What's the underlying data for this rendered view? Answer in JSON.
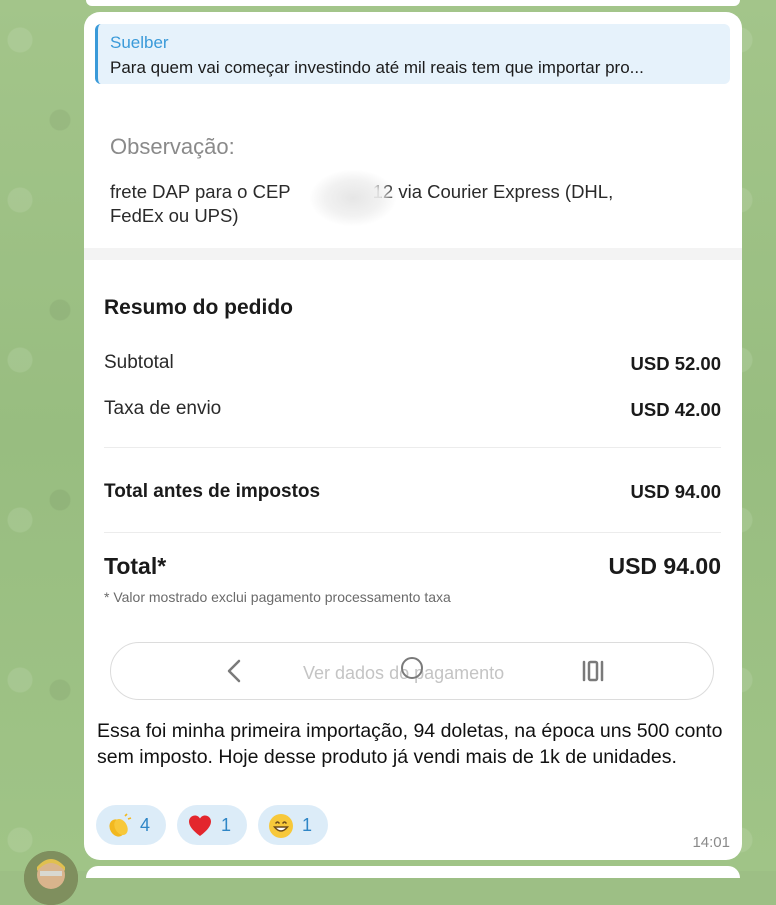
{
  "reply": {
    "author": "Suelber",
    "text": "Para quem vai começar investindo até mil reais tem que importar pro..."
  },
  "observation": {
    "label": "Observação:",
    "text_before": "frete DAP para o CEP",
    "text_after": "12 via Courier Express (DHL, FedEx ou UPS)"
  },
  "summary": {
    "title": "Resumo do pedido",
    "rows": [
      {
        "label": "Subtotal",
        "value": "USD 52.00"
      },
      {
        "label": "Taxa de envio",
        "value": "USD 42.00"
      },
      {
        "label": "Total antes de impostos",
        "value": "USD 94.00"
      }
    ],
    "total_label": "Total*",
    "total_value": "USD 94.00",
    "footnote": "* Valor mostrado exclui pagamento processamento taxa"
  },
  "nav": {
    "label": "Ver dados do pagamento",
    "icons": [
      "back-icon",
      "home-icon",
      "recents-icon"
    ]
  },
  "caption": "Essa foi minha primeira importação, 94 doletas, na época uns 500 conto sem imposto. Hoje desse produto já vendi mais de 1k de unidades.",
  "reactions": [
    {
      "icon": "clapping-hands-icon",
      "count": "4"
    },
    {
      "icon": "red-heart-icon",
      "count": "1"
    },
    {
      "icon": "grinning-face-icon",
      "count": "1"
    }
  ],
  "time": "14:01",
  "colors": {
    "accent": "#3a9ad9",
    "reaction_bg": "#dcecf8",
    "wallpaper": "#9dbf85"
  }
}
